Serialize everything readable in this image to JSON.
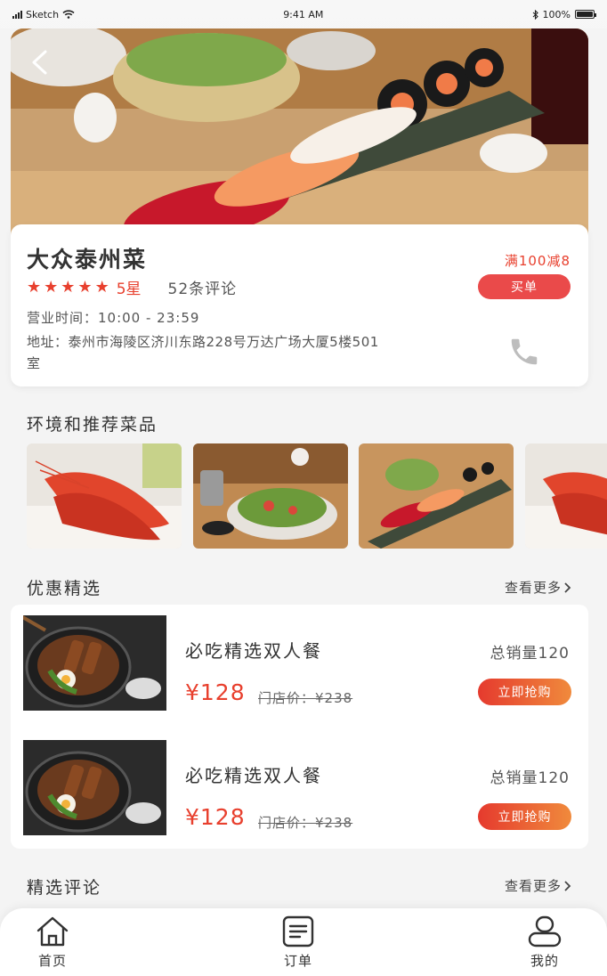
{
  "status_bar": {
    "carrier": "Sketch",
    "time": "9:41 AM",
    "battery": "100%"
  },
  "shop": {
    "name": "大众泰州菜",
    "stars": 5,
    "rating_text": "5星",
    "review_count": "52条评论",
    "promo": "满100减8",
    "buy_label": "买单",
    "hours": "营业时间：10:00 - 23:59",
    "address": "地址：泰州市海陵区济川东路228号万达广场大厦5楼501室"
  },
  "gallery": {
    "title": "环境和推荐菜品",
    "images": [
      "shrimp-photo",
      "salad-photo",
      "sushi-photo",
      "shrimp-photo"
    ]
  },
  "deals": {
    "title": "优惠精选",
    "see_more": "查看更多",
    "items": [
      {
        "name": "必吃精选双人餐",
        "price": "¥128",
        "original_price": "门店价：¥238",
        "sales": "总销量120",
        "button": "立即抢购"
      },
      {
        "name": "必吃精选双人餐",
        "price": "¥128",
        "original_price": "门店价：¥238",
        "sales": "总销量120",
        "button": "立即抢购"
      }
    ]
  },
  "reviews": {
    "title": "精选评论",
    "see_more": "查看更多"
  },
  "tab_bar": {
    "items": [
      {
        "label": "首页",
        "icon": "home-icon"
      },
      {
        "label": "订单",
        "icon": "order-icon"
      },
      {
        "label": "我的",
        "icon": "profile-icon"
      }
    ]
  },
  "colors": {
    "accent": "#e8402e",
    "button_gradient_end": "#f08a3c",
    "background": "#f4f4f4"
  }
}
